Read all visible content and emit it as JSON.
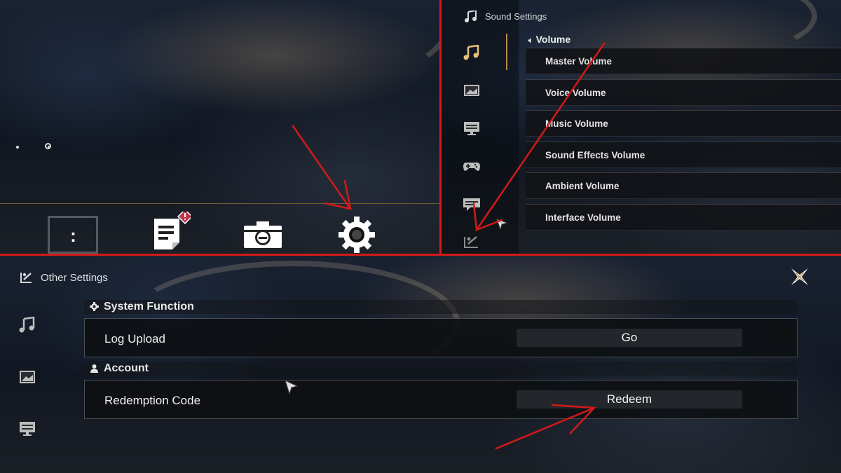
{
  "sound_panel": {
    "title": "Sound Settings",
    "section": "Volume",
    "rows": [
      "Master Volume",
      "Voice Volume",
      "Music Volume",
      "Sound Effects Volume",
      "Ambient Volume",
      "Interface Volume"
    ],
    "sidebar_icons": [
      "music-icon",
      "image-icon",
      "display-icon",
      "gamepad-icon",
      "chat-icon",
      "other-settings-icon"
    ]
  },
  "toolbar": {
    "icons": [
      "bracket-colon-icon",
      "notes-icon",
      "alert-badge-icon",
      "camera-icon",
      "gear-icon"
    ],
    "colon": ":"
  },
  "other_panel": {
    "title": "Other Settings",
    "sections": [
      {
        "header": "System Function",
        "row_label": "Log Upload",
        "button": "Go"
      },
      {
        "header": "Account",
        "row_label": "Redemption Code",
        "button": "Redeem"
      }
    ],
    "sidebar_icons": [
      "music-icon",
      "image-icon",
      "display-icon"
    ]
  },
  "colors": {
    "annotation_red": "#d21a1a",
    "accent_gold": "#b58b4a",
    "row_bg": "#121418"
  }
}
